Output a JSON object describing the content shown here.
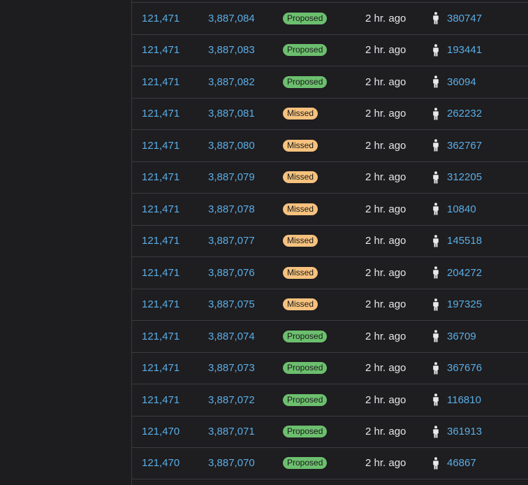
{
  "theme": {
    "link_color": "#5aaee5",
    "proposed_color": "#6cbf6e",
    "missed_color": "#f6c27e",
    "background": "#1d1c1f"
  },
  "table": {
    "rows": [
      {
        "epoch": "121,471",
        "slot": "3,887,084",
        "status": "Proposed",
        "status_type": "proposed",
        "age": "2 hr. ago",
        "proposer_icon": "person-icon",
        "proposer": "380747"
      },
      {
        "epoch": "121,471",
        "slot": "3,887,083",
        "status": "Proposed",
        "status_type": "proposed",
        "age": "2 hr. ago",
        "proposer_icon": "person-icon",
        "proposer": "193441"
      },
      {
        "epoch": "121,471",
        "slot": "3,887,082",
        "status": "Proposed",
        "status_type": "proposed",
        "age": "2 hr. ago",
        "proposer_icon": "person-icon",
        "proposer": "36094"
      },
      {
        "epoch": "121,471",
        "slot": "3,887,081",
        "status": "Missed",
        "status_type": "missed",
        "age": "2 hr. ago",
        "proposer_icon": "person-icon",
        "proposer": "262232"
      },
      {
        "epoch": "121,471",
        "slot": "3,887,080",
        "status": "Missed",
        "status_type": "missed",
        "age": "2 hr. ago",
        "proposer_icon": "person-icon",
        "proposer": "362767"
      },
      {
        "epoch": "121,471",
        "slot": "3,887,079",
        "status": "Missed",
        "status_type": "missed",
        "age": "2 hr. ago",
        "proposer_icon": "person-icon",
        "proposer": "312205"
      },
      {
        "epoch": "121,471",
        "slot": "3,887,078",
        "status": "Missed",
        "status_type": "missed",
        "age": "2 hr. ago",
        "proposer_icon": "person-icon",
        "proposer": "10840"
      },
      {
        "epoch": "121,471",
        "slot": "3,887,077",
        "status": "Missed",
        "status_type": "missed",
        "age": "2 hr. ago",
        "proposer_icon": "person-icon",
        "proposer": "145518"
      },
      {
        "epoch": "121,471",
        "slot": "3,887,076",
        "status": "Missed",
        "status_type": "missed",
        "age": "2 hr. ago",
        "proposer_icon": "person-icon",
        "proposer": "204272"
      },
      {
        "epoch": "121,471",
        "slot": "3,887,075",
        "status": "Missed",
        "status_type": "missed",
        "age": "2 hr. ago",
        "proposer_icon": "person-icon",
        "proposer": "197325"
      },
      {
        "epoch": "121,471",
        "slot": "3,887,074",
        "status": "Proposed",
        "status_type": "proposed",
        "age": "2 hr. ago",
        "proposer_icon": "person-icon",
        "proposer": "36709"
      },
      {
        "epoch": "121,471",
        "slot": "3,887,073",
        "status": "Proposed",
        "status_type": "proposed",
        "age": "2 hr. ago",
        "proposer_icon": "person-icon",
        "proposer": "367676"
      },
      {
        "epoch": "121,471",
        "slot": "3,887,072",
        "status": "Proposed",
        "status_type": "proposed",
        "age": "2 hr. ago",
        "proposer_icon": "person-icon",
        "proposer": "116810"
      },
      {
        "epoch": "121,470",
        "slot": "3,887,071",
        "status": "Proposed",
        "status_type": "proposed",
        "age": "2 hr. ago",
        "proposer_icon": "person-icon",
        "proposer": "361913"
      },
      {
        "epoch": "121,470",
        "slot": "3,887,070",
        "status": "Proposed",
        "status_type": "proposed",
        "age": "2 hr. ago",
        "proposer_icon": "person-icon",
        "proposer": "46867"
      }
    ]
  }
}
